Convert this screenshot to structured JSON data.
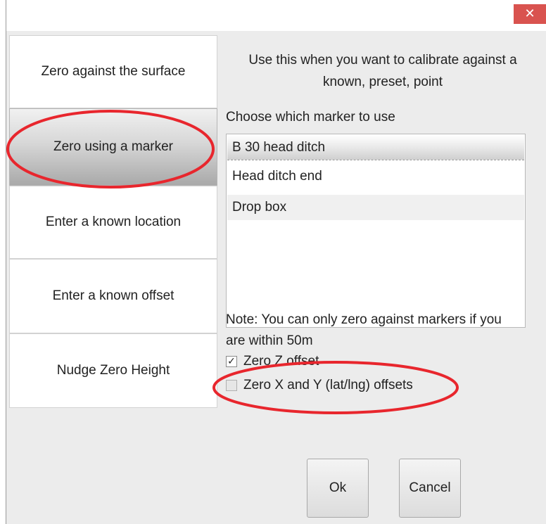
{
  "window": {
    "close_glyph": "✕"
  },
  "options": [
    {
      "label": "Zero against the surface",
      "selected": false
    },
    {
      "label": "Zero using a marker",
      "selected": true
    },
    {
      "label": "Enter a known location",
      "selected": false
    },
    {
      "label": "Enter a known offset",
      "selected": false
    },
    {
      "label": "Nudge Zero Height",
      "selected": false
    }
  ],
  "description": {
    "line1": "Use this when you want to calibrate against a",
    "line2": "known, preset, point"
  },
  "marker_section": {
    "label": "Choose which marker to use",
    "markers": [
      "B 30 head ditch",
      "Head ditch end",
      "Drop box"
    ],
    "selected_marker": "B 30 head ditch"
  },
  "note": {
    "line1": "Note: You can only zero against markers if you",
    "line2": "are within 50m"
  },
  "checkboxes": {
    "zero_z": {
      "label": "Zero Z offset",
      "checked": true,
      "check_glyph": "✓"
    },
    "zero_xy": {
      "label": "Zero X and Y (lat/lng) offsets",
      "checked": false
    }
  },
  "buttons": {
    "ok": "Ok",
    "cancel": "Cancel"
  },
  "colors": {
    "annotation_red": "#e8262d",
    "close_red": "#d9534f"
  }
}
